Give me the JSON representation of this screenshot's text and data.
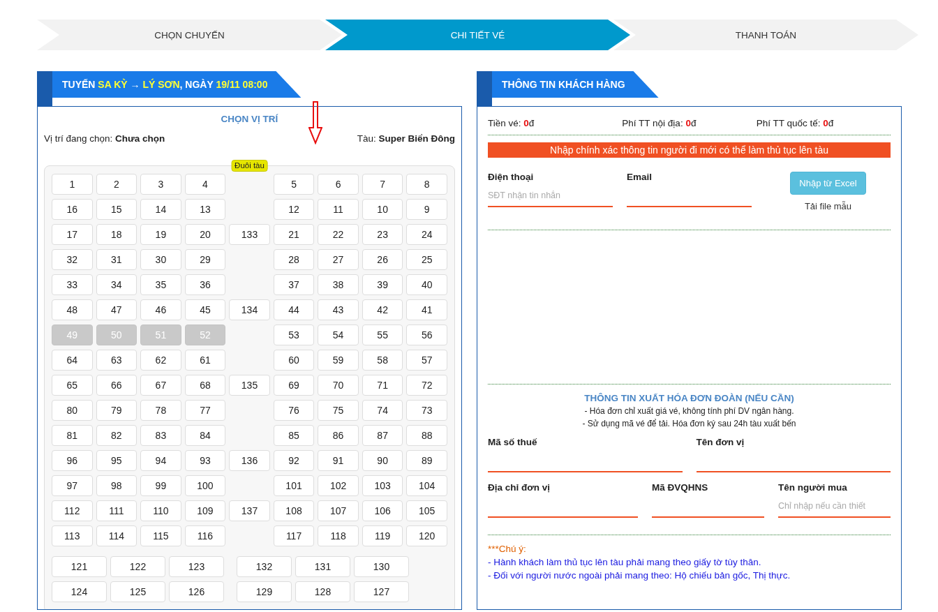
{
  "steps": [
    {
      "label": "CHỌN CHUYẾN",
      "selected": false
    },
    {
      "label": "CHI TIẾT VÉ",
      "selected": true
    },
    {
      "label": "THANH TOÁN",
      "selected": false
    }
  ],
  "trip_panel": {
    "title": [
      {
        "text": "TUYẾN ",
        "highlight": false
      },
      {
        "text": "SA KỲ",
        "highlight": true
      },
      {
        "text": " → ",
        "highlight": false
      },
      {
        "text": "LÝ SƠN",
        "highlight": true
      },
      {
        "text": ", NGÀY ",
        "highlight": false
      },
      {
        "text": "19/11 08:00",
        "highlight": true
      }
    ],
    "heading": "CHỌN VỊ TRÍ",
    "selected_seat": {
      "label": "Vị trí đang chọn:",
      "value": "Chưa chọn"
    },
    "vessel": {
      "label": "Tàu:",
      "value": "Super Biển Đông"
    },
    "stern_label": "Đuôi tàu",
    "rows": [
      {
        "left": [
          {
            "label": "1",
            "disabled": false
          },
          {
            "label": "2",
            "disabled": false
          },
          {
            "label": "3",
            "disabled": false
          },
          {
            "label": "4",
            "disabled": false
          }
        ],
        "right": [
          {
            "label": "5",
            "disabled": false
          },
          {
            "label": "6",
            "disabled": false
          },
          {
            "label": "7",
            "disabled": false
          },
          {
            "label": "8",
            "disabled": false
          }
        ]
      },
      {
        "left": [
          {
            "label": "16",
            "disabled": false
          },
          {
            "label": "15",
            "disabled": false
          },
          {
            "label": "14",
            "disabled": false
          },
          {
            "label": "13",
            "disabled": false
          }
        ],
        "right": [
          {
            "label": "12",
            "disabled": false
          },
          {
            "label": "11",
            "disabled": false
          },
          {
            "label": "10",
            "disabled": false
          },
          {
            "label": "9",
            "disabled": false
          }
        ]
      },
      {
        "left": [
          {
            "label": "17",
            "disabled": false
          },
          {
            "label": "18",
            "disabled": false
          },
          {
            "label": "19",
            "disabled": false
          },
          {
            "label": "20",
            "disabled": false
          }
        ],
        "middle": {
          "label": "133",
          "disabled": false
        },
        "right": [
          {
            "label": "21",
            "disabled": false
          },
          {
            "label": "22",
            "disabled": false
          },
          {
            "label": "23",
            "disabled": false
          },
          {
            "label": "24",
            "disabled": false
          }
        ]
      },
      {
        "left": [
          {
            "label": "32",
            "disabled": false
          },
          {
            "label": "31",
            "disabled": false
          },
          {
            "label": "30",
            "disabled": false
          },
          {
            "label": "29",
            "disabled": false
          }
        ],
        "right": [
          {
            "label": "28",
            "disabled": false
          },
          {
            "label": "27",
            "disabled": false
          },
          {
            "label": "26",
            "disabled": false
          },
          {
            "label": "25",
            "disabled": false
          }
        ]
      },
      {
        "left": [
          {
            "label": "33",
            "disabled": false
          },
          {
            "label": "34",
            "disabled": false
          },
          {
            "label": "35",
            "disabled": false
          },
          {
            "label": "36",
            "disabled": false
          }
        ],
        "right": [
          {
            "label": "37",
            "disabled": false
          },
          {
            "label": "38",
            "disabled": false
          },
          {
            "label": "39",
            "disabled": false
          },
          {
            "label": "40",
            "disabled": false
          }
        ]
      },
      {
        "left": [
          {
            "label": "48",
            "disabled": false
          },
          {
            "label": "47",
            "disabled": false
          },
          {
            "label": "46",
            "disabled": false
          },
          {
            "label": "45",
            "disabled": false
          }
        ],
        "middle": {
          "label": "134",
          "disabled": false
        },
        "right": [
          {
            "label": "44",
            "disabled": false
          },
          {
            "label": "43",
            "disabled": false
          },
          {
            "label": "42",
            "disabled": false
          },
          {
            "label": "41",
            "disabled": false
          }
        ]
      },
      {
        "left": [
          {
            "label": "49",
            "disabled": true
          },
          {
            "label": "50",
            "disabled": true
          },
          {
            "label": "51",
            "disabled": true
          },
          {
            "label": "52",
            "disabled": true
          }
        ],
        "right": [
          {
            "label": "53",
            "disabled": false
          },
          {
            "label": "54",
            "disabled": false
          },
          {
            "label": "55",
            "disabled": false
          },
          {
            "label": "56",
            "disabled": false
          }
        ]
      },
      {
        "left": [
          {
            "label": "64",
            "disabled": false
          },
          {
            "label": "63",
            "disabled": false
          },
          {
            "label": "62",
            "disabled": false
          },
          {
            "label": "61",
            "disabled": false
          }
        ],
        "right": [
          {
            "label": "60",
            "disabled": false
          },
          {
            "label": "59",
            "disabled": false
          },
          {
            "label": "58",
            "disabled": false
          },
          {
            "label": "57",
            "disabled": false
          }
        ]
      },
      {
        "left": [
          {
            "label": "65",
            "disabled": false
          },
          {
            "label": "66",
            "disabled": false
          },
          {
            "label": "67",
            "disabled": false
          },
          {
            "label": "68",
            "disabled": false
          }
        ],
        "middle": {
          "label": "135",
          "disabled": false
        },
        "right": [
          {
            "label": "69",
            "disabled": false
          },
          {
            "label": "70",
            "disabled": false
          },
          {
            "label": "71",
            "disabled": false
          },
          {
            "label": "72",
            "disabled": false
          }
        ]
      },
      {
        "left": [
          {
            "label": "80",
            "disabled": false
          },
          {
            "label": "79",
            "disabled": false
          },
          {
            "label": "78",
            "disabled": false
          },
          {
            "label": "77",
            "disabled": false
          }
        ],
        "right": [
          {
            "label": "76",
            "disabled": false
          },
          {
            "label": "75",
            "disabled": false
          },
          {
            "label": "74",
            "disabled": false
          },
          {
            "label": "73",
            "disabled": false
          }
        ]
      },
      {
        "left": [
          {
            "label": "81",
            "disabled": false
          },
          {
            "label": "82",
            "disabled": false
          },
          {
            "label": "83",
            "disabled": false
          },
          {
            "label": "84",
            "disabled": false
          }
        ],
        "right": [
          {
            "label": "85",
            "disabled": false
          },
          {
            "label": "86",
            "disabled": false
          },
          {
            "label": "87",
            "disabled": false
          },
          {
            "label": "88",
            "disabled": false
          }
        ]
      },
      {
        "left": [
          {
            "label": "96",
            "disabled": false
          },
          {
            "label": "95",
            "disabled": false
          },
          {
            "label": "94",
            "disabled": false
          },
          {
            "label": "93",
            "disabled": false
          }
        ],
        "middle": {
          "label": "136",
          "disabled": false
        },
        "right": [
          {
            "label": "92",
            "disabled": false
          },
          {
            "label": "91",
            "disabled": false
          },
          {
            "label": "90",
            "disabled": false
          },
          {
            "label": "89",
            "disabled": false
          }
        ]
      },
      {
        "left": [
          {
            "label": "97",
            "disabled": false
          },
          {
            "label": "98",
            "disabled": false
          },
          {
            "label": "99",
            "disabled": false
          },
          {
            "label": "100",
            "disabled": false
          }
        ],
        "right": [
          {
            "label": "101",
            "disabled": false
          },
          {
            "label": "102",
            "disabled": false
          },
          {
            "label": "103",
            "disabled": false
          },
          {
            "label": "104",
            "disabled": false
          }
        ]
      },
      {
        "left": [
          {
            "label": "112",
            "disabled": false
          },
          {
            "label": "111",
            "disabled": false
          },
          {
            "label": "110",
            "disabled": false
          },
          {
            "label": "109",
            "disabled": false
          }
        ],
        "middle": {
          "label": "137",
          "disabled": false
        },
        "right": [
          {
            "label": "108",
            "disabled": false
          },
          {
            "label": "107",
            "disabled": false
          },
          {
            "label": "106",
            "disabled": false
          },
          {
            "label": "105",
            "disabled": false
          }
        ]
      },
      {
        "left": [
          {
            "label": "113",
            "disabled": false
          },
          {
            "label": "114",
            "disabled": false
          },
          {
            "label": "115",
            "disabled": false
          },
          {
            "label": "116",
            "disabled": false
          }
        ],
        "right": [
          {
            "label": "117",
            "disabled": false
          },
          {
            "label": "118",
            "disabled": false
          },
          {
            "label": "119",
            "disabled": false
          },
          {
            "label": "120",
            "disabled": false
          }
        ]
      }
    ],
    "bottom_rows": [
      {
        "left": [
          {
            "label": "121",
            "disabled": false
          },
          {
            "label": "122",
            "disabled": false
          },
          {
            "label": "123",
            "disabled": false
          }
        ],
        "right": [
          {
            "label": "132",
            "disabled": false
          },
          {
            "label": "131",
            "disabled": false
          },
          {
            "label": "130",
            "disabled": false
          }
        ]
      },
      {
        "left": [
          {
            "label": "124",
            "disabled": false
          },
          {
            "label": "125",
            "disabled": false
          },
          {
            "label": "126",
            "disabled": false
          }
        ],
        "right": [
          {
            "label": "129",
            "disabled": false
          },
          {
            "label": "128",
            "disabled": false
          },
          {
            "label": "127",
            "disabled": false
          }
        ]
      }
    ]
  },
  "customer_panel": {
    "title": "THÔNG TIN KHÁCH HÀNG",
    "fees": [
      {
        "label": "Tiền vé:",
        "amount": "0",
        "unit": "đ"
      },
      {
        "label": "Phí TT nội địa:",
        "amount": "0",
        "unit": "đ"
      },
      {
        "label": "Phí TT quốc tế:",
        "amount": "0",
        "unit": "đ"
      }
    ],
    "notice": "Nhập chính xác thông tin người đi mới có thể làm thủ tục lên tàu",
    "contact_fields": [
      {
        "label": "Điện thoại",
        "placeholder": "SĐT nhận tin nhắn"
      },
      {
        "label": "Email"
      }
    ],
    "import_button": "Nhập từ Excel",
    "template_link": "Tải file mẫu",
    "invoice": {
      "heading": "THÔNG TIN XUẤT HÓA ĐƠN ĐOÀN (NẾU CẦN)",
      "notes": [
        "- Hóa đơn chỉ xuất giá vé, không tính phí DV ngân hàng.",
        "- Sử dụng mã vé để tải. Hóa đơn ký sau 24h tàu xuất bến"
      ],
      "fields_row_1": [
        {
          "label": "Mã số thuế"
        },
        {
          "label": "Tên đơn vị"
        }
      ],
      "fields_row_2": [
        {
          "label": "Địa chỉ đơn vị"
        },
        {
          "label": "Mã ĐVQHNS"
        },
        {
          "label": "Tên người mua",
          "placeholder": "Chỉ nhập nếu cần thiết"
        }
      ]
    },
    "caution_title": "***Chú ý:",
    "cautions": [
      "- Hành khách làm thủ tục lên tàu phải mang theo giấy tờ tùy thân.",
      "- Đối với người nước ngoài phải mang theo: Hộ chiếu bản gốc, Thị thực."
    ]
  }
}
